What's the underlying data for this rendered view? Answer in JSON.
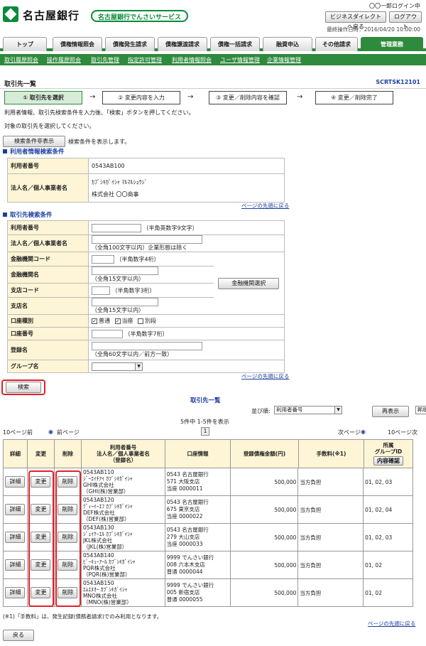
{
  "header": {
    "bank_name": "名古屋銀行",
    "service_name": "名古屋銀行でんさいサービス",
    "user_name": "〇〇一郎ログイン中",
    "biz_direct_label": "ビジネスダイレクトへ戻る",
    "logout_label": "ログアウト",
    "last_operation": "最終操作日時：2016/04/20 10:00:00"
  },
  "tabs": [
    "トップ",
    "債権情報照会",
    "債権発生請求",
    "債権譲渡請求",
    "債権一括請求",
    "融資申込",
    "その他請求",
    "管理業務"
  ],
  "subnav": [
    "取引履歴照会",
    "操作履歴照会",
    "取引先管理",
    "指定許可管理",
    "利用者情報照会",
    "ユーザ情報管理",
    "企業情報管理"
  ],
  "page": {
    "title": "取引先一覧",
    "screen_id": "SCRTSK12101"
  },
  "steps": [
    "① 取引先を選択",
    "② 変更内容を入力",
    "③ 変更／削除内容を確認",
    "④ 変更／削除完了"
  ],
  "instructions": {
    "line1": "利用者情報、取引先検索条件を入力後、「検索」ボタンを押してください。",
    "line2": "対象の取引先を選択してください。",
    "toggle_button": "検索条件非表示",
    "toggle_note": "検索条件を表示します。"
  },
  "user_info": {
    "section_title": "利用者情報検索条件",
    "number_label": "利用者番号",
    "number_value": "0543AB100",
    "name_label": "法人名／個人事業者名",
    "name_kana": "ｶﾌﾞｼｷｶﾞｲｼｬ ﾏﾙﾏﾙｼｮｳｼﾞ",
    "name_value": "株式会社 〇〇商事"
  },
  "top_link": "ページの先頭に戻る",
  "search": {
    "section_title": "取引先検索条件",
    "user_number": {
      "label": "利用者番号",
      "hint": "（半角英数字9文字）"
    },
    "corp_name": {
      "label": "法人名／個人事業者名",
      "hint": "（全角100文字以内）企業形態は除く"
    },
    "bank_code": {
      "label": "金融機関コード",
      "hint": "（半角数字4桁）"
    },
    "bank_name": {
      "label": "金融機関名",
      "hint": "（全角15文字以内）"
    },
    "branch_code": {
      "label": "支店コード",
      "hint": "（半角数字3桁）"
    },
    "branch_name": {
      "label": "支店名",
      "hint": "（全角15文字以内）"
    },
    "bank_select_button": "金融機関選択",
    "account_type": {
      "label": "口座種別",
      "opt1": "普通",
      "opt2": "当座",
      "opt3": "別段"
    },
    "account_number": {
      "label": "口座番号",
      "hint": "（半角数字7桁）"
    },
    "registered_name": {
      "label": "登録名",
      "hint": "（全角60文字以内／前方一致）"
    },
    "group_name": {
      "label": "グループ名"
    },
    "search_button": "検索"
  },
  "results": {
    "title": "取引先一覧",
    "sort_label": "並び順:",
    "sort_value": "利用者番号",
    "order_value": "昇順",
    "redisplay_button": "再表示",
    "count_text": "5件中 1-5件を表示",
    "prev10": "10ページ前",
    "prev": "前ページ",
    "page": "1",
    "next": "次ページ",
    "next10": "10ページ次",
    "headers": {
      "detail": "詳細",
      "change": "変更",
      "delete": "削除",
      "user": "利用者番号\n法人名／個人事業者名\n（登録名）",
      "account": "口座情報",
      "amount": "登録債権金額(円)",
      "fee": "手数料(※1)",
      "group": "所属\nグループID",
      "content_confirm": "内容確認"
    },
    "rows": [
      {
        "id": "0543AB110",
        "kana": "ｼﾞｰｴｲﾁｱｲ ｶﾌﾞｼｷｶﾞｲｼｬ",
        "name": "GHI株式会社",
        "reg": "（GHI(株)営業部）",
        "acct1": "0543 名古屋銀行",
        "acct2": "571 大阪支店",
        "acct3": "当座 0000011",
        "amount": "500,000",
        "fee": "当方負担",
        "group": "01, 02, 03"
      },
      {
        "id": "0543AB120",
        "kana": "ﾃﾞｨｰｲｰｴﾌ ｶﾌﾞｼｷｶﾞｲｼｬ",
        "name": "DEF株式会社",
        "reg": "（DEF(株)営業部）",
        "acct1": "0543 名古屋銀行",
        "acct2": "675 東京支店",
        "acct3": "当座 0000022",
        "amount": "500,000",
        "fee": "当方負担",
        "group": "01, 02, 04"
      },
      {
        "id": "0543AB130",
        "kana": "ｼﾞｪｲｹｰｴﾙ ｶﾌﾞｼｷｶﾞｲｼｬ",
        "name": "JKL株式会社",
        "reg": "（JKL(株)営業部）",
        "acct1": "0543 名古屋銀行",
        "acct2": "279 大山支店",
        "acct3": "当座 0000033",
        "amount": "500,000",
        "fee": "当方負担",
        "group": "01, 02, 03"
      },
      {
        "id": "0543AB140",
        "kana": "ﾋﾟｰｷｭｰｱｰﾙ ｶﾌﾞｼｷｶﾞｲｼｬ",
        "name": "PQR株式会社",
        "reg": "（PQR(株)営業部）",
        "acct1": "9999 でんさい銀行",
        "acct2": "008 六本木支店",
        "acct3": "普通 0000044",
        "amount": "500,000",
        "fee": "当方負担",
        "group": "01, 02"
      },
      {
        "id": "0543AB150",
        "kana": "ｴﾑｴﾇｵｰ ｶﾌﾞｼｷｶﾞｲｼｬ",
        "name": "MNO株式会社",
        "reg": "（MNO(株)営業部）",
        "acct1": "9999 でんさい銀行",
        "acct2": "005 新宿支店",
        "acct3": "普通 0000055",
        "amount": "500,000",
        "fee": "当方負担",
        "group": "01, 02"
      }
    ],
    "detail_button": "詳細",
    "change_button": "変更",
    "delete_button": "削除"
  },
  "footnote": "(※1)「手数料」は、発生記録(債務者請求)でのみ利用となります。",
  "back_button": "戻る",
  "colors": {
    "brand_green": "#2e8a3c",
    "link_blue": "#1a3fa0",
    "label_bg": "#fdf5d6",
    "highlight_red": "#e3202a"
  }
}
